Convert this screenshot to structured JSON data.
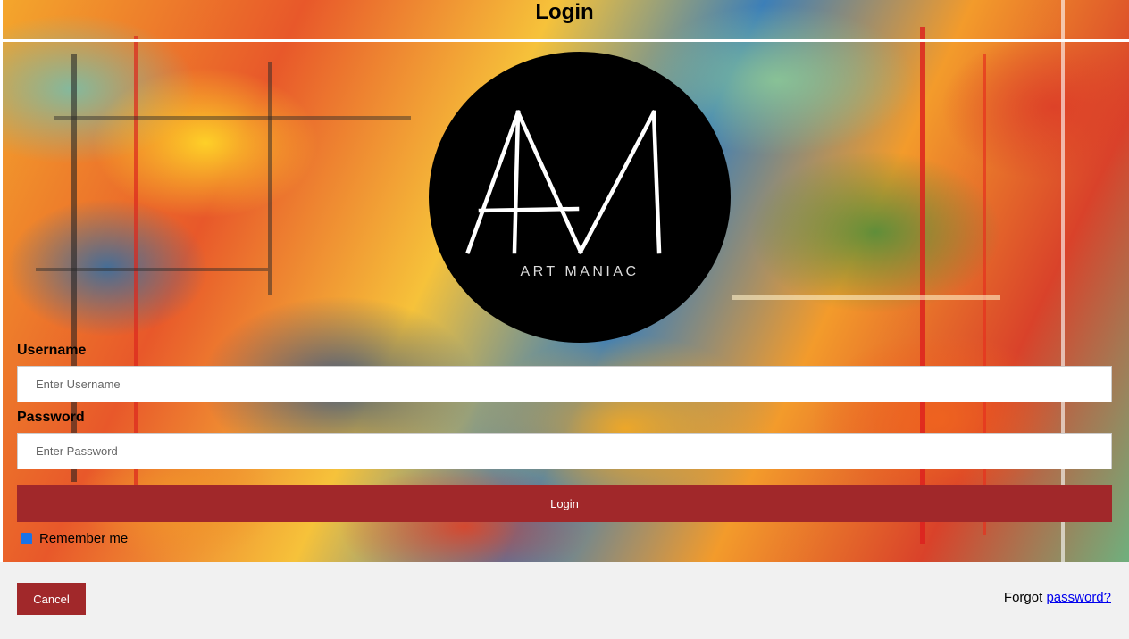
{
  "header": {
    "title": "Login"
  },
  "logo": {
    "text": "ART MANIAC"
  },
  "form": {
    "username_label": "Username",
    "username_placeholder": "Enter Username",
    "password_label": "Password",
    "password_placeholder": "Enter Password",
    "login_label": "Login",
    "remember_label": "Remember me"
  },
  "footer": {
    "cancel_label": "Cancel",
    "forgot_prefix": "Forgot",
    "forgot_link": "password?"
  },
  "colors": {
    "button": "#a1282a",
    "checkbox": "#1a73e8",
    "link": "#0000ee"
  }
}
